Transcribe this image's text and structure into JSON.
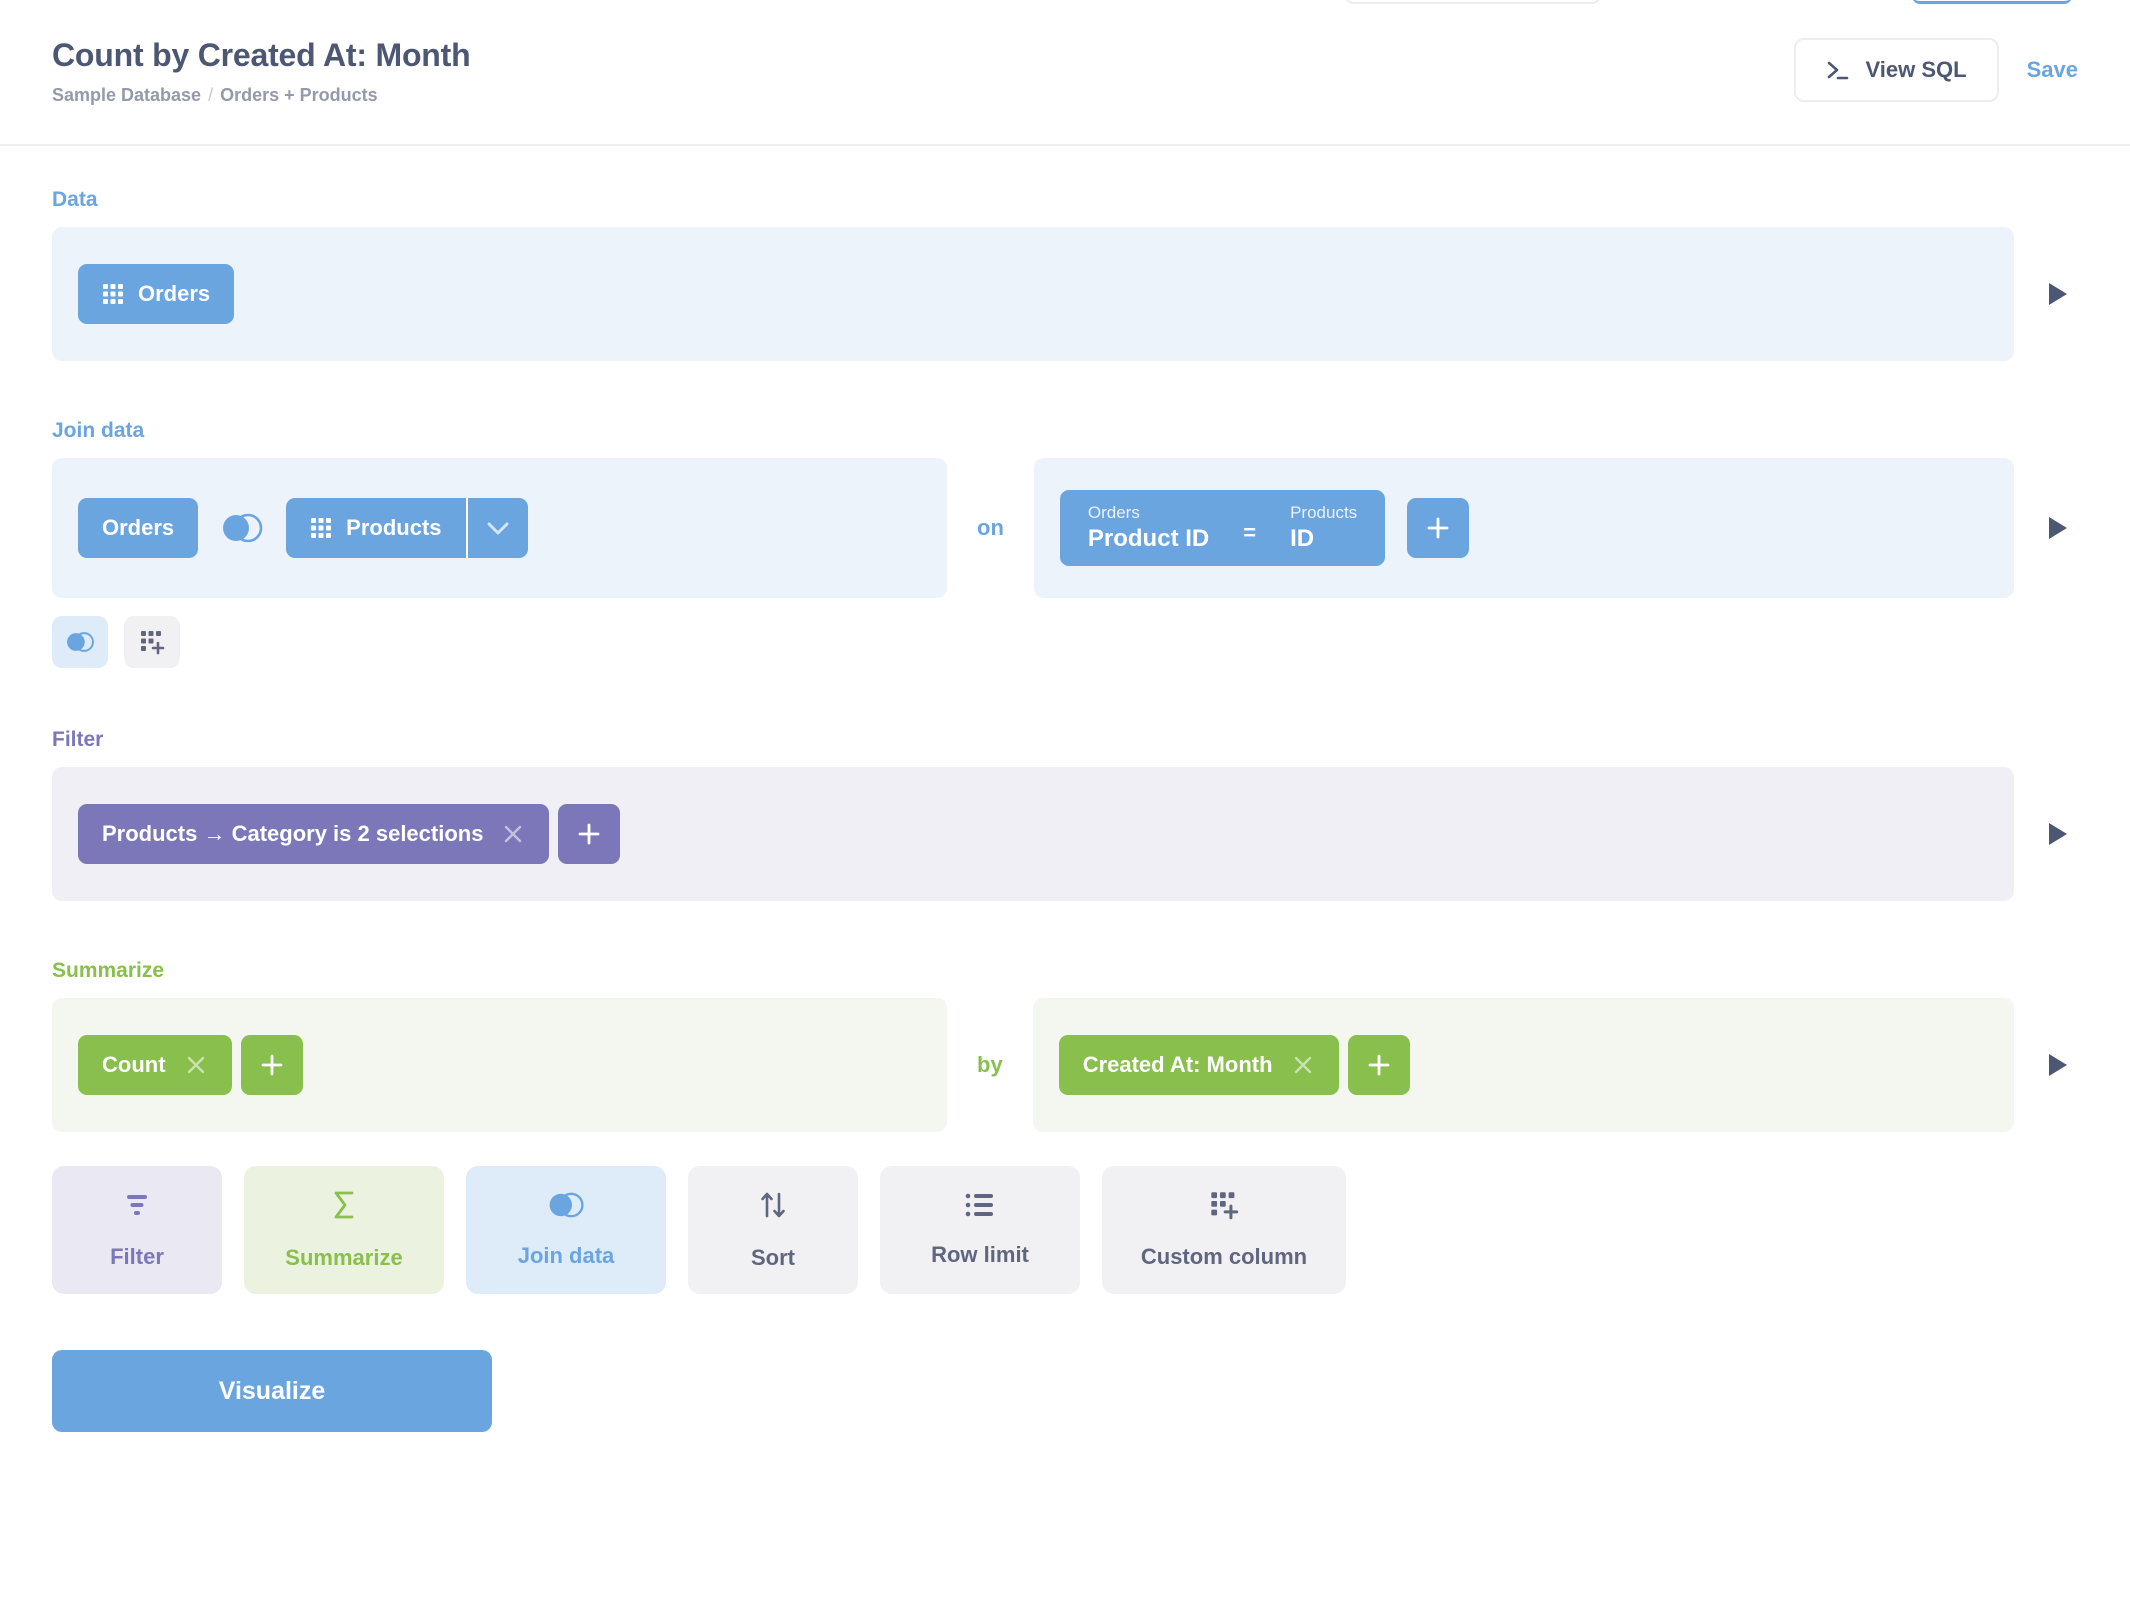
{
  "header": {
    "title": "Count by Created At: Month",
    "breadcrumb_database": "Sample Database",
    "breadcrumb_separator": "/",
    "breadcrumb_tables": "Orders + Products",
    "view_sql_label": "View SQL",
    "save_label": "Save"
  },
  "data_section": {
    "label": "Data",
    "table": "Orders"
  },
  "join_section": {
    "label": "Join data",
    "left_table": "Orders",
    "right_table": "Products",
    "on_word": "on",
    "condition": {
      "left_table": "Orders",
      "left_field": "Product ID",
      "operator": "=",
      "right_table": "Products",
      "right_field": "ID"
    },
    "add_condition_label": "+"
  },
  "filter_section": {
    "label": "Filter",
    "filters": [
      {
        "text": "Products → Category is 2 selections"
      }
    ],
    "add_label": "+"
  },
  "summarize_section": {
    "label": "Summarize",
    "aggregations": [
      {
        "text": "Count"
      }
    ],
    "by_word": "by",
    "breakouts": [
      {
        "text": "Created At: Month"
      }
    ],
    "add_label": "+"
  },
  "action_buttons": [
    {
      "label": "Filter",
      "icon": "filter-icon"
    },
    {
      "label": "Summarize",
      "icon": "sigma-icon"
    },
    {
      "label": "Join data",
      "icon": "venn-icon"
    },
    {
      "label": "Sort",
      "icon": "sort-arrows-icon"
    },
    {
      "label": "Row limit",
      "icon": "list-icon"
    },
    {
      "label": "Custom column",
      "icon": "grid-plus-icon"
    }
  ],
  "visualize_label": "Visualize",
  "colors": {
    "blue": "#6BA5E0",
    "purple": "#7C77B9",
    "green": "#88BF4D",
    "text": "#4C5773",
    "muted": "#949AAB"
  }
}
